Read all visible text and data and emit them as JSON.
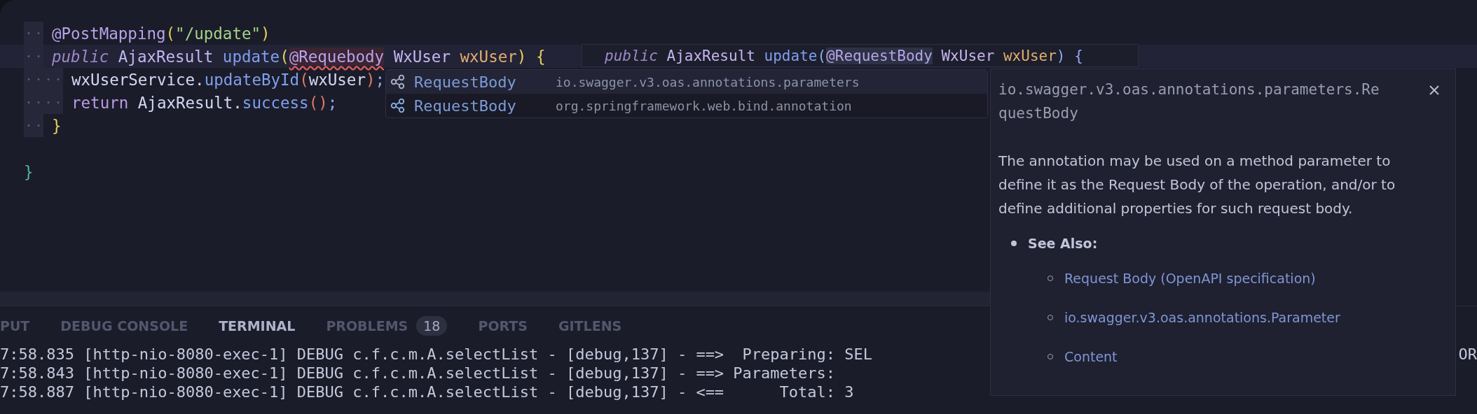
{
  "editor": {
    "lines": [
      {
        "kind": "member",
        "current": false,
        "tokens": [
          {
            "text": "@PostMapping",
            "kind": "annotation"
          },
          {
            "text": "(",
            "kind": "bracket"
          },
          {
            "text": "\"/update\"",
            "kind": "string"
          },
          {
            "text": ")",
            "kind": "bracket"
          }
        ]
      },
      {
        "kind": "member",
        "current": true,
        "tokens": [
          {
            "text": "public",
            "kind": "keyword"
          },
          {
            "text": " AjaxResult ",
            "kind": "type"
          },
          {
            "text": "update",
            "kind": "function"
          },
          {
            "text": "(",
            "kind": "bracket"
          },
          {
            "text": "@Requebody",
            "kind": "error"
          },
          {
            "text": " WxUser ",
            "kind": "type"
          },
          {
            "text": "wxUser",
            "kind": "param"
          },
          {
            "text": ")",
            "kind": "bracket"
          },
          {
            "text": " {",
            "kind": "bracket"
          }
        ]
      },
      {
        "kind": "body",
        "current": false,
        "tokens": [
          {
            "text": "wxUserService.",
            "kind": "plain"
          },
          {
            "text": "updateById",
            "kind": "function"
          },
          {
            "text": "(",
            "kind": "paren"
          },
          {
            "text": "wxUser",
            "kind": "plain"
          },
          {
            "text": ")",
            "kind": "paren"
          },
          {
            "text": ";",
            "kind": "punct"
          }
        ]
      },
      {
        "kind": "body",
        "current": false,
        "tokens": [
          {
            "text": "return",
            "kind": "keyword2"
          },
          {
            "text": " AjaxResult.",
            "kind": "plain"
          },
          {
            "text": "success",
            "kind": "function"
          },
          {
            "text": "()",
            "kind": "paren"
          },
          {
            "text": ";",
            "kind": "punct"
          }
        ]
      },
      {
        "kind": "member",
        "current": false,
        "tokens": [
          {
            "text": "}",
            "kind": "bracket"
          }
        ]
      },
      {
        "kind": "outer",
        "current": false,
        "tokens": [
          {
            "text": "}",
            "kind": "outerbrace"
          }
        ]
      }
    ]
  },
  "signature": {
    "tokens": [
      {
        "text": "public",
        "kind": "keyword"
      },
      {
        "text": " AjaxResult ",
        "kind": "type"
      },
      {
        "text": "update",
        "kind": "function"
      },
      {
        "text": "(",
        "kind": "paren2"
      },
      {
        "text": "@RequestBody",
        "kind": "active"
      },
      {
        "text": " WxUser ",
        "kind": "type"
      },
      {
        "text": "wxUser",
        "kind": "param"
      },
      {
        "text": ")",
        "kind": "paren2"
      },
      {
        "text": " {",
        "kind": "paren2"
      }
    ]
  },
  "suggestions": [
    {
      "label": "RequestBody",
      "detail": "io.swagger.v3.oas.annotations.parameters",
      "selected": true
    },
    {
      "label": "RequestBody",
      "detail": "org.springframework.web.bind.annotation",
      "selected": false
    }
  ],
  "doc": {
    "title": "io.swagger.v3.oas.annotations.parameters.RequestBody",
    "description": "The annotation may be used on a method parameter to define it as the Request Body of the operation, and/or to define additional properties for such request body.",
    "see_also": "See Also:",
    "links": [
      "Request Body (OpenAPI specification)",
      "io.swagger.v3.oas.annotations.Parameter",
      "Content"
    ]
  },
  "panel": {
    "tabs": [
      {
        "label": "PUT",
        "selected": false
      },
      {
        "label": "DEBUG CONSOLE",
        "selected": false
      },
      {
        "label": "TERMINAL",
        "selected": true
      },
      {
        "label": "PROBLEMS",
        "selected": false,
        "badge": "18"
      },
      {
        "label": "PORTS",
        "selected": false
      },
      {
        "label": "GITLENS",
        "selected": false
      }
    ],
    "terminal_lines": [
      {
        "text": "7:58.835 [http-nio-8080-exec-1] DEBUG c.f.c.m.A.selectList - [debug,137] - ==>  Preparing: SEL",
        "tail": "OR"
      },
      {
        "text": "7:58.843 [http-nio-8080-exec-1] DEBUG c.f.c.m.A.selectList - [debug,137] - ==> Parameters:"
      },
      {
        "text": "7:58.887 [http-nio-8080-exec-1] DEBUG c.f.c.m.A.selectList - [debug,137] - <==      Total: 3"
      }
    ]
  }
}
